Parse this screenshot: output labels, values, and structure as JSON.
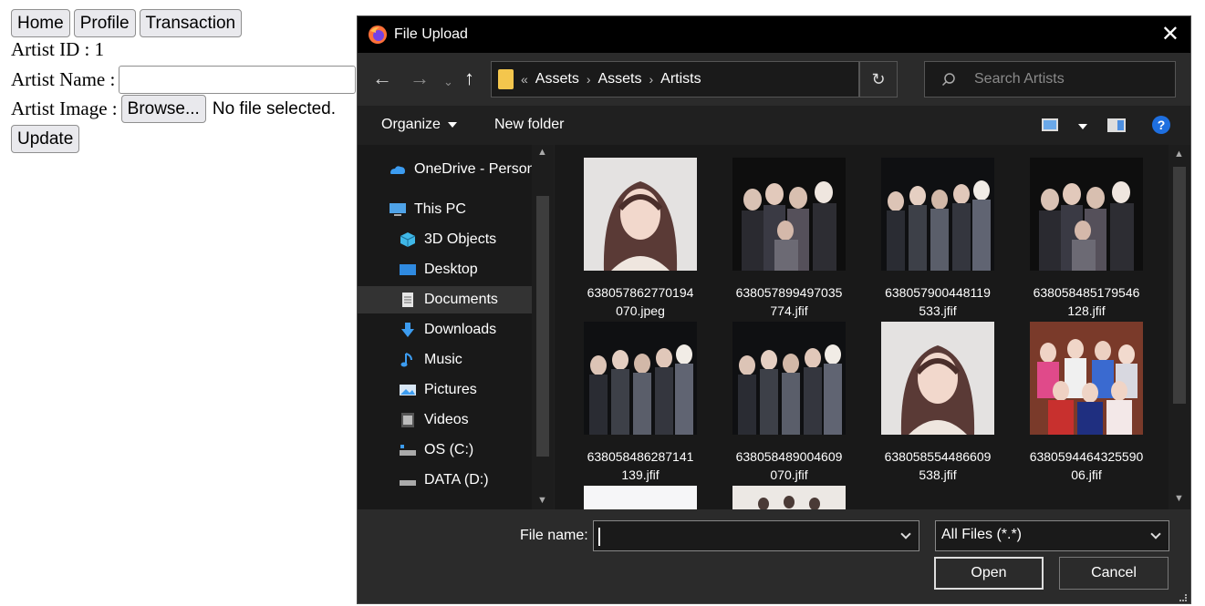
{
  "page": {
    "nav": [
      "Home",
      "Profile",
      "Transaction"
    ],
    "artist_id_label": "Artist ID : 1",
    "artist_name_label": "Artist Name :",
    "artist_image_label": "Artist Image :",
    "browse_label": "Browse...",
    "no_file_label": "No file selected.",
    "update_label": "Update"
  },
  "dialog": {
    "title": "File Upload",
    "breadcrumb_prefix": "«",
    "breadcrumb": [
      "Assets",
      "Assets",
      "Artists"
    ],
    "search_placeholder": "Search Artists",
    "toolbar": {
      "organize": "Organize",
      "new_folder": "New folder",
      "help": "?"
    },
    "nav_items": [
      {
        "label": "OneDrive - Personal",
        "icon": "onedrive-icon"
      },
      {
        "label": "This PC",
        "icon": "computer-icon"
      },
      {
        "label": "3D Objects",
        "icon": "3d-objects-icon"
      },
      {
        "label": "Desktop",
        "icon": "desktop-icon"
      },
      {
        "label": "Documents",
        "icon": "documents-icon",
        "selected": true
      },
      {
        "label": "Downloads",
        "icon": "downloads-icon"
      },
      {
        "label": "Music",
        "icon": "music-icon"
      },
      {
        "label": "Pictures",
        "icon": "pictures-icon"
      },
      {
        "label": "Videos",
        "icon": "videos-icon"
      },
      {
        "label": "OS (C:)",
        "icon": "drive-c-icon"
      },
      {
        "label": "DATA (D:)",
        "icon": "drive-d-icon"
      }
    ],
    "files": [
      {
        "line1": "638057862770194",
        "line2": "070.jpeg",
        "kind": "portrait"
      },
      {
        "line1": "638057899497035",
        "line2": "774.jfif",
        "kind": "group-dark"
      },
      {
        "line1": "638057900448119",
        "line2": "533.jfif",
        "kind": "group-dark"
      },
      {
        "line1": "638058485179546",
        "line2": "128.jfif",
        "kind": "group-dark"
      },
      {
        "line1": "638058486287141",
        "line2": "139.jfif",
        "kind": "group-dark"
      },
      {
        "line1": "638058489004609",
        "line2": "070.jfif",
        "kind": "group-dark"
      },
      {
        "line1": "638058554486609",
        "line2": "538.jfif",
        "kind": "portrait"
      },
      {
        "line1": "6380594464325590",
        "line2": "06.jfif",
        "kind": "group-colorful"
      },
      {
        "line1": "",
        "line2": "",
        "kind": "partial-light"
      },
      {
        "line1": "",
        "line2": "",
        "kind": "partial-group-light"
      }
    ],
    "file_name_label": "File name:",
    "file_name_value": "",
    "file_type": "All Files (*.*)",
    "open_label": "Open",
    "cancel_label": "Cancel",
    "colors": {
      "titlebar": "#000000",
      "background": "#202020",
      "pane": "#191919",
      "accent": "#1e6fe0"
    }
  }
}
